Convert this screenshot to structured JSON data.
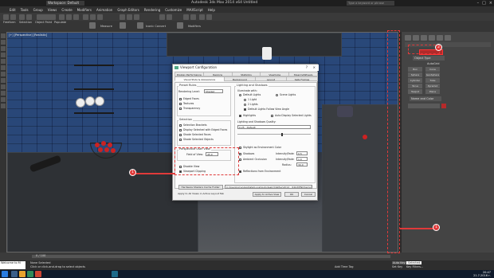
{
  "app": {
    "title": "Autodesk 3ds Max 2014 x64    Untitled",
    "workspace": "Workspace: Default",
    "search_placeholder": "Type a keyword or phrase"
  },
  "menu": [
    "Edit",
    "Tools",
    "Group",
    "Views",
    "Create",
    "Modifiers",
    "Animation",
    "Graph Editors",
    "Rendering",
    "Customize",
    "MAXScript",
    "Help"
  ],
  "toolbar2": {
    "items": [
      "Freeform",
      "Selection",
      "Object Paint",
      "Populate"
    ],
    "labels": [
      "Polygon Modeling",
      "Measure",
      "Iconic Convert",
      "Modifiers"
    ]
  },
  "viewport": {
    "label": "[+] [Perspective] [Realistic]"
  },
  "command_panel": {
    "section_object_type": "Object Type",
    "auto_grid": "AutoGrid",
    "buttons": [
      "Box",
      "Cone",
      "Sphere",
      "GeoSphere",
      "Cylinder",
      "Tube",
      "Torus",
      "Pyramid",
      "Teapot",
      "Plane"
    ],
    "section_name_color": "Name and Color"
  },
  "dialog": {
    "title": "Viewport Configuration",
    "tabs_row1": [
      "Display Performance",
      "Regions",
      "Statistics",
      "ViewCube",
      "SteeringWheels"
    ],
    "tabs_row2": [
      "Visual Style & Appearance",
      "Background",
      "Layout",
      "Safe Frames"
    ],
    "preset_group": "Preset Rules",
    "rendering_level_label": "Rendering Level:",
    "rendering_level_value": "Shaded",
    "preset_checks": [
      "Edged Faces",
      "Textures",
      "Transparency"
    ],
    "selection_group": "Selection",
    "selection_checks": [
      "Selection Brackets",
      "Display Selected with Edged Faces",
      "Shade Selected Faces",
      "Shade Selected Objects"
    ],
    "perspective_group": "Perspective User View",
    "fov_label": "Field of View:",
    "fov_value": "45.0",
    "disable_view": "Disable View",
    "viewport_clipping": "Viewport Clipping",
    "lighting_group": "Lighting and Shadows",
    "illuminate_label": "Illuminate with:",
    "illuminate_options": [
      "Default Lights",
      "Scene Lights"
    ],
    "light_options": [
      "1 Light",
      "2 Lights"
    ],
    "default_lights_follow": "Default Lights Follow View Angle",
    "highlights": "Highlights",
    "auto_display_selected": "Auto Display Selected Lights",
    "quality_label": "Lighting and Shadows Quality:",
    "quality_value": "0.25 - Default",
    "skylight_label": "Skylight as Environment Color",
    "ao_label": "Ambient Occlusion",
    "ao_intensity": "Intensity/Fade:",
    "ao_intensity_val": "1.0",
    "ao_radius": "Radius:",
    "ao_radius_val": "30.0",
    "shadows_label": "Shadows",
    "shadows_intensity": "Intensity/Fade:",
    "shadows_val": "0.5",
    "reflections": "Reflections from Environment",
    "hardware_cache_btn": "Hardware Shaders Cache Folder:",
    "cache_path": "C:\\Users\\nme\\AppData\\Local\\Autodesk\\3dsMax\\2014 - 64bit\\ENU\\temp\\HWShaders",
    "apply_all_btn": "Apply to All Views in Active Layout Tab",
    "apply_active_btn": "Apply to Active View",
    "ok_btn": "OK",
    "cancel_btn": "Cancel"
  },
  "callouts": {
    "one_a": "1",
    "one_b": "1",
    "two": "2"
  },
  "timeline": {
    "frame": "0 / 100"
  },
  "status": {
    "script": "Welcome to M",
    "none_selected": "None Selected",
    "hint": "Click or click-and-drag to select objects",
    "add_time_tag": "Add Time Tag",
    "autokey": "Auto Key",
    "selected": "Selected",
    "set_key": "Set Key",
    "key_filters": "Key Filters..."
  },
  "taskbar": {
    "time": "20:47",
    "date": "21.7.2016 г."
  },
  "colors": {
    "accent_red": "#e03a3a"
  }
}
